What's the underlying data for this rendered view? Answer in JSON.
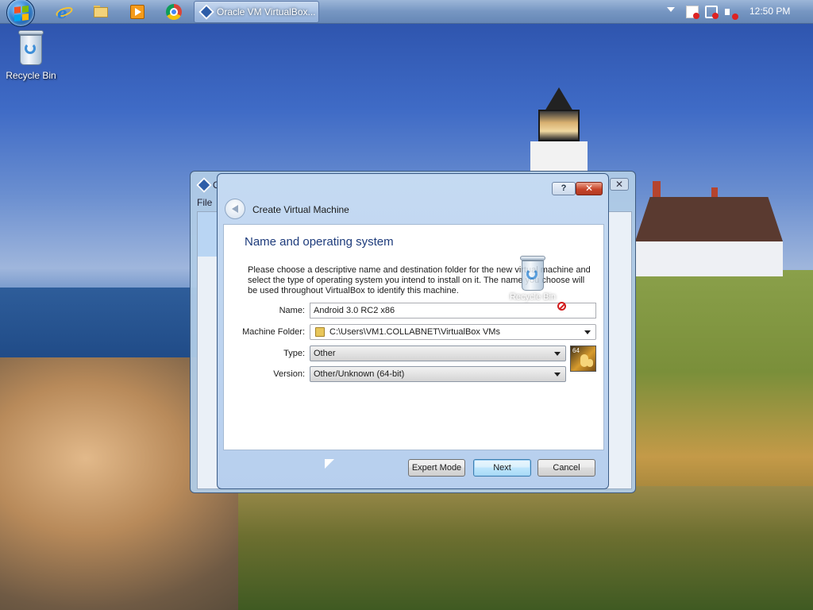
{
  "taskbar": {
    "active_task_label": "Oracle VM VirtualBox...",
    "clock": "12:50 PM",
    "pinned": [
      "internet-explorer-icon",
      "windows-explorer-icon",
      "media-player-icon",
      "chrome-icon"
    ]
  },
  "desktop": {
    "recycle_bin_label": "Recycle Bin",
    "drag_ghost_label": "Recycle Bin"
  },
  "background_window": {
    "title": "O",
    "menu": "File"
  },
  "dialog": {
    "window_title": "Create Virtual Machine",
    "help_label": "?",
    "close_label": "✕",
    "heading": "Name and operating system",
    "description": "Please choose a descriptive name and destination folder for the new virtual machine and select the type of operating system you intend to install on it. The name you choose will be used throughout VirtualBox to identify this machine.",
    "name_label": "Name:",
    "name_value": "Android 3.0 RC2 x86",
    "folder_label": "Machine Folder:",
    "folder_value": "C:\\Users\\VM1.COLLABNET\\VirtualBox VMs",
    "type_label": "Type:",
    "type_value": "Other",
    "version_label": "Version:",
    "version_value": "Other/Unknown (64-bit)",
    "os_icon_badge": "64",
    "buttons": {
      "expert": "Expert Mode",
      "next": "Next",
      "cancel": "Cancel"
    }
  },
  "colors": {
    "heading": "#1d3b7b",
    "dialog_frame": "#c5daf2",
    "close_button": "#c7452b"
  }
}
